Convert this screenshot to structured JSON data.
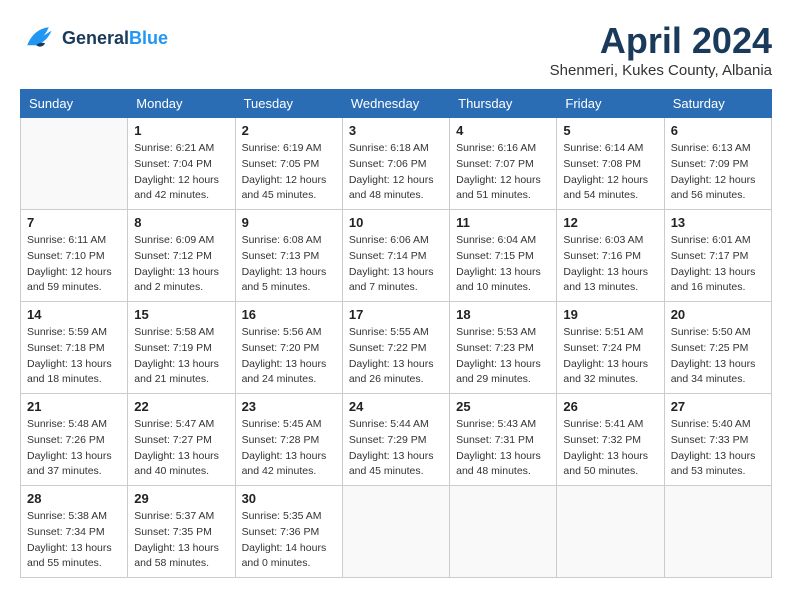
{
  "header": {
    "logo_line1": "General",
    "logo_line2": "Blue",
    "month_title": "April 2024",
    "location": "Shenmeri, Kukes County, Albania"
  },
  "weekdays": [
    "Sunday",
    "Monday",
    "Tuesday",
    "Wednesday",
    "Thursday",
    "Friday",
    "Saturday"
  ],
  "weeks": [
    [
      {
        "day": "",
        "info": ""
      },
      {
        "day": "1",
        "info": "Sunrise: 6:21 AM\nSunset: 7:04 PM\nDaylight: 12 hours\nand 42 minutes."
      },
      {
        "day": "2",
        "info": "Sunrise: 6:19 AM\nSunset: 7:05 PM\nDaylight: 12 hours\nand 45 minutes."
      },
      {
        "day": "3",
        "info": "Sunrise: 6:18 AM\nSunset: 7:06 PM\nDaylight: 12 hours\nand 48 minutes."
      },
      {
        "day": "4",
        "info": "Sunrise: 6:16 AM\nSunset: 7:07 PM\nDaylight: 12 hours\nand 51 minutes."
      },
      {
        "day": "5",
        "info": "Sunrise: 6:14 AM\nSunset: 7:08 PM\nDaylight: 12 hours\nand 54 minutes."
      },
      {
        "day": "6",
        "info": "Sunrise: 6:13 AM\nSunset: 7:09 PM\nDaylight: 12 hours\nand 56 minutes."
      }
    ],
    [
      {
        "day": "7",
        "info": "Sunrise: 6:11 AM\nSunset: 7:10 PM\nDaylight: 12 hours\nand 59 minutes."
      },
      {
        "day": "8",
        "info": "Sunrise: 6:09 AM\nSunset: 7:12 PM\nDaylight: 13 hours\nand 2 minutes."
      },
      {
        "day": "9",
        "info": "Sunrise: 6:08 AM\nSunset: 7:13 PM\nDaylight: 13 hours\nand 5 minutes."
      },
      {
        "day": "10",
        "info": "Sunrise: 6:06 AM\nSunset: 7:14 PM\nDaylight: 13 hours\nand 7 minutes."
      },
      {
        "day": "11",
        "info": "Sunrise: 6:04 AM\nSunset: 7:15 PM\nDaylight: 13 hours\nand 10 minutes."
      },
      {
        "day": "12",
        "info": "Sunrise: 6:03 AM\nSunset: 7:16 PM\nDaylight: 13 hours\nand 13 minutes."
      },
      {
        "day": "13",
        "info": "Sunrise: 6:01 AM\nSunset: 7:17 PM\nDaylight: 13 hours\nand 16 minutes."
      }
    ],
    [
      {
        "day": "14",
        "info": "Sunrise: 5:59 AM\nSunset: 7:18 PM\nDaylight: 13 hours\nand 18 minutes."
      },
      {
        "day": "15",
        "info": "Sunrise: 5:58 AM\nSunset: 7:19 PM\nDaylight: 13 hours\nand 21 minutes."
      },
      {
        "day": "16",
        "info": "Sunrise: 5:56 AM\nSunset: 7:20 PM\nDaylight: 13 hours\nand 24 minutes."
      },
      {
        "day": "17",
        "info": "Sunrise: 5:55 AM\nSunset: 7:22 PM\nDaylight: 13 hours\nand 26 minutes."
      },
      {
        "day": "18",
        "info": "Sunrise: 5:53 AM\nSunset: 7:23 PM\nDaylight: 13 hours\nand 29 minutes."
      },
      {
        "day": "19",
        "info": "Sunrise: 5:51 AM\nSunset: 7:24 PM\nDaylight: 13 hours\nand 32 minutes."
      },
      {
        "day": "20",
        "info": "Sunrise: 5:50 AM\nSunset: 7:25 PM\nDaylight: 13 hours\nand 34 minutes."
      }
    ],
    [
      {
        "day": "21",
        "info": "Sunrise: 5:48 AM\nSunset: 7:26 PM\nDaylight: 13 hours\nand 37 minutes."
      },
      {
        "day": "22",
        "info": "Sunrise: 5:47 AM\nSunset: 7:27 PM\nDaylight: 13 hours\nand 40 minutes."
      },
      {
        "day": "23",
        "info": "Sunrise: 5:45 AM\nSunset: 7:28 PM\nDaylight: 13 hours\nand 42 minutes."
      },
      {
        "day": "24",
        "info": "Sunrise: 5:44 AM\nSunset: 7:29 PM\nDaylight: 13 hours\nand 45 minutes."
      },
      {
        "day": "25",
        "info": "Sunrise: 5:43 AM\nSunset: 7:31 PM\nDaylight: 13 hours\nand 48 minutes."
      },
      {
        "day": "26",
        "info": "Sunrise: 5:41 AM\nSunset: 7:32 PM\nDaylight: 13 hours\nand 50 minutes."
      },
      {
        "day": "27",
        "info": "Sunrise: 5:40 AM\nSunset: 7:33 PM\nDaylight: 13 hours\nand 53 minutes."
      }
    ],
    [
      {
        "day": "28",
        "info": "Sunrise: 5:38 AM\nSunset: 7:34 PM\nDaylight: 13 hours\nand 55 minutes."
      },
      {
        "day": "29",
        "info": "Sunrise: 5:37 AM\nSunset: 7:35 PM\nDaylight: 13 hours\nand 58 minutes."
      },
      {
        "day": "30",
        "info": "Sunrise: 5:35 AM\nSunset: 7:36 PM\nDaylight: 14 hours\nand 0 minutes."
      },
      {
        "day": "",
        "info": ""
      },
      {
        "day": "",
        "info": ""
      },
      {
        "day": "",
        "info": ""
      },
      {
        "day": "",
        "info": ""
      }
    ]
  ]
}
